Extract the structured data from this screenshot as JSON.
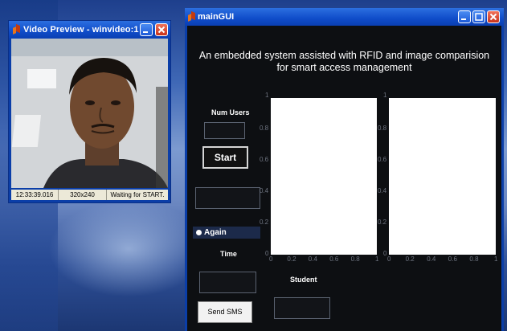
{
  "video_window": {
    "title": "Video Preview - winvideo:1",
    "status_time": "12:33:39.016",
    "status_resolution": "320x240",
    "status_message": "Waiting for START."
  },
  "main_window": {
    "title": "mainGUI",
    "heading_line1": "An embedded system assisted with RFID and  image comparision",
    "heading_line2": "for smart access management",
    "num_users_label": "Num Users",
    "start_label": "Start",
    "again_label": "Again",
    "time_label": "Time",
    "student_label": "Student",
    "send_sms_label": "Send SMS"
  },
  "axes": {
    "y_ticks": [
      "1",
      "0.8",
      "0.6",
      "0.4",
      "0.2",
      "0"
    ],
    "x_ticks": [
      "0",
      "0.2",
      "0.4",
      "0.6",
      "0.8",
      "1"
    ]
  },
  "colors": {
    "title_bar": "#0f4cc9",
    "close_button": "#c9321b",
    "gui_background": "#0d0f12"
  }
}
